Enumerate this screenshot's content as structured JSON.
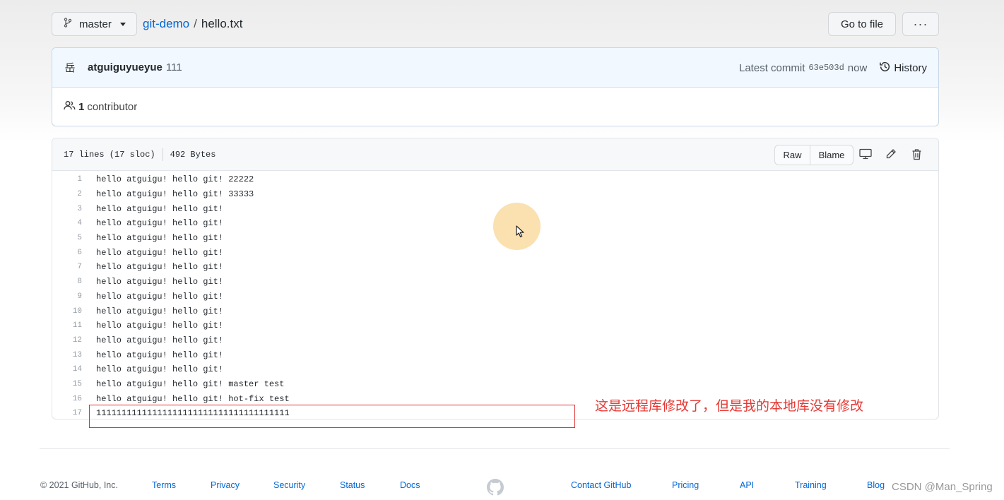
{
  "header": {
    "branch_label": "master",
    "repo_name": "git-demo",
    "separator": "/",
    "file_name": "hello.txt",
    "goto_file_label": "Go to file",
    "more_label": "···"
  },
  "commit": {
    "avatar_glyph": "岳",
    "author": "atguiguyueyue",
    "message": "111",
    "latest_commit_label": "Latest commit",
    "sha": "63e503d",
    "time": "now",
    "history_label": "History",
    "contributor_count": "1",
    "contributor_label": "contributor"
  },
  "file": {
    "lines_info": "17 lines (17 sloc)",
    "size_info": "492 Bytes",
    "raw_label": "Raw",
    "blame_label": "Blame",
    "lines": [
      {
        "num": "1",
        "text": "hello atguigu! hello git! 22222"
      },
      {
        "num": "2",
        "text": "hello atguigu! hello git! 33333"
      },
      {
        "num": "3",
        "text": "hello atguigu! hello git!"
      },
      {
        "num": "4",
        "text": "hello atguigu! hello git!"
      },
      {
        "num": "5",
        "text": "hello atguigu! hello git!"
      },
      {
        "num": "6",
        "text": "hello atguigu! hello git!"
      },
      {
        "num": "7",
        "text": "hello atguigu! hello git!"
      },
      {
        "num": "8",
        "text": "hello atguigu! hello git!"
      },
      {
        "num": "9",
        "text": "hello atguigu! hello git!"
      },
      {
        "num": "10",
        "text": "hello atguigu! hello git!"
      },
      {
        "num": "11",
        "text": "hello atguigu! hello git!"
      },
      {
        "num": "12",
        "text": "hello atguigu! hello git!"
      },
      {
        "num": "13",
        "text": "hello atguigu! hello git!"
      },
      {
        "num": "14",
        "text": "hello atguigu! hello git!"
      },
      {
        "num": "15",
        "text": "hello atguigu! hello git! master test"
      },
      {
        "num": "16",
        "text": "hello atguigu! hello git! hot-fix test"
      },
      {
        "num": "17",
        "text": "11111111111111111111111111111111111111"
      }
    ]
  },
  "annotation": {
    "text": "这是远程库修改了，但是我的本地库没有修改",
    "color": "#e53935"
  },
  "footer": {
    "copyright": "© 2021 GitHub, Inc.",
    "links_left": [
      "Terms",
      "Privacy",
      "Security",
      "Status",
      "Docs"
    ],
    "links_right": [
      "Contact GitHub",
      "Pricing",
      "API",
      "Training",
      "Blog"
    ],
    "watermark": "CSDN @Man_Spring"
  },
  "colors": {
    "link": "#0366d6",
    "commit_header_bg": "#f1f8ff",
    "annotation_red": "#e53935"
  }
}
